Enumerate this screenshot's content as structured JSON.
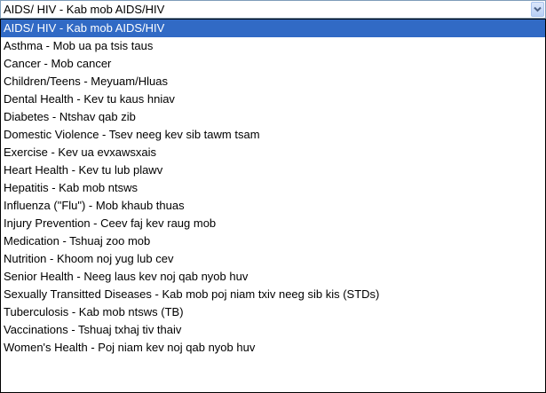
{
  "select": {
    "value": "AIDS/ HIV - Kab mob AIDS/HIV",
    "selected_index": 0
  },
  "colors": {
    "selected_background": "#316ac5",
    "selected_text": "#ffffff",
    "border": "#7f9db9"
  },
  "icons": {
    "dropdown": "chevron-down-icon"
  },
  "options": [
    "AIDS/ HIV - Kab mob AIDS/HIV",
    "Asthma - Mob ua pa tsis taus",
    "Cancer - Mob cancer",
    "Children/Teens - Meyuam/Hluas",
    "Dental Health - Kev tu kaus hniav",
    "Diabetes - Ntshav qab zib",
    "Domestic Violence - Tsev neeg kev sib tawm tsam",
    "Exercise - Kev ua evxawsxais",
    "Heart Health - Kev tu lub plawv",
    "Hepatitis - Kab mob ntsws",
    "Influenza (\"Flu\") - Mob khaub thuas",
    "Injury Prevention - Ceev faj kev raug mob",
    "Medication - Tshuaj zoo mob",
    "Nutrition - Khoom noj yug lub cev",
    "Senior Health - Neeg laus kev noj qab nyob huv",
    "Sexually Transitted Diseases - Kab mob poj niam txiv neeg sib kis (STDs)",
    "Tuberculosis - Kab mob ntsws (TB)",
    "Vaccinations - Tshuaj txhaj tiv thaiv",
    "Women's Health - Poj niam kev noj qab nyob huv"
  ]
}
